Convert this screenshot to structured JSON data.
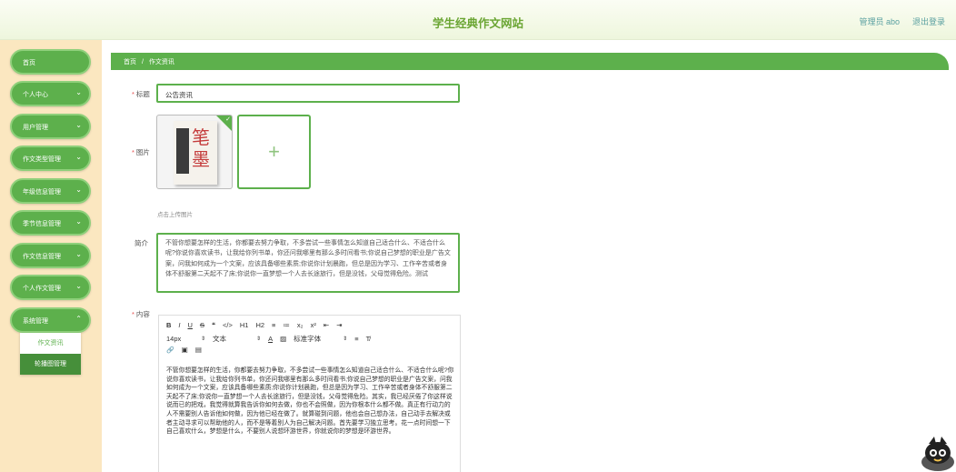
{
  "header": {
    "title": "学生经典作文网站",
    "user": "管理员 abo",
    "logout": "退出登录"
  },
  "sidebar": {
    "items": [
      {
        "label": "首页",
        "chevron": false
      },
      {
        "label": "个人中心",
        "chevron": true
      },
      {
        "label": "用户管理",
        "chevron": true
      },
      {
        "label": "作文类型管理",
        "chevron": true
      },
      {
        "label": "年级信息管理",
        "chevron": true
      },
      {
        "label": "季节信息管理",
        "chevron": true
      },
      {
        "label": "作文信息管理",
        "chevron": true
      },
      {
        "label": "个人作文管理",
        "chevron": true
      },
      {
        "label": "系统管理",
        "chevron": true
      }
    ],
    "submenu": [
      "作文资讯",
      "轮播图管理"
    ]
  },
  "breadcrumb": {
    "home": "首页",
    "sep": "/",
    "current": "作文资讯"
  },
  "form": {
    "title_label": "标题",
    "title_value": "公告资讯",
    "image_label": "图片",
    "upload_hint": "点击上传图片",
    "intro_label": "简介",
    "intro_value": "不管你想要怎样的生活，你都要去努力争取，不多尝试一些事情怎么知道自己适合什么、不适合什么呢?你说你喜欢读书，让我给你列书单，你还问我哪里有那么多时间看书;你说自己梦想的职业是广告文案，问我如何成为一个文案，应该具备哪些素质;你说你计划晨跑，但总是因为学习、工作辛苦或者身体不舒服第二天起不了床;你说你一直梦想一个人去长途旅行，但是没钱，父母觉得危险。测试",
    "content_label": "内容",
    "toolbar": {
      "row1": [
        "B",
        "I",
        "U",
        "S",
        "❝",
        "</>",
        "H1",
        "H2",
        "≡",
        "≔",
        "x₂",
        "x²",
        "⇤",
        "⇥"
      ],
      "row2": {
        "size": "14px",
        "font": "文本",
        "color_icon": "A",
        "bg_icon": "▨",
        "family": "标准字体",
        "align_icon": "≡",
        "clear_icon": "T̸"
      },
      "row3": [
        "🔗",
        "▣",
        "▤"
      ]
    },
    "content_value": "不管你想要怎样的生活，你都要去努力争取，不多尝试一些事情怎么知道自己适合什么、不适合什么呢?你说你喜欢读书，让我给你列书单，你还问我哪里有那么多时间看书;你说自己梦想的职业是广告文案，问我如何成为一个文案，应该具备哪些素质;你说你计划晨跑，但总是因为学习、工作辛苦或者身体不舒服第二天起不了床;你说你一直梦想一个人去长途旅行，但是没钱，父母觉得危险。其实，我已经厌倦了你这样说说而已的把戏，我觉得就算我告诉你如何去做，你也不会照做，因为你根本什么都不做。真正有行动力的人不需要别人告诉他如何做，因为他已经在做了。就算碰到问题，他也会自己想办法，自己动手去解决或者主动寻求可以帮助他的人，而不是等着别人为自己解决问题。首先要学习独立思考。花一点时间想一下自己喜欢什么，梦想是什么，不要别人说想环游世界，你就说你的梦想是环游世界。"
  },
  "colors": {
    "primary": "#5db04c",
    "sidebar_bg": "#fbe7c0",
    "title": "#6aa532",
    "active_sub": "#468f3a"
  }
}
